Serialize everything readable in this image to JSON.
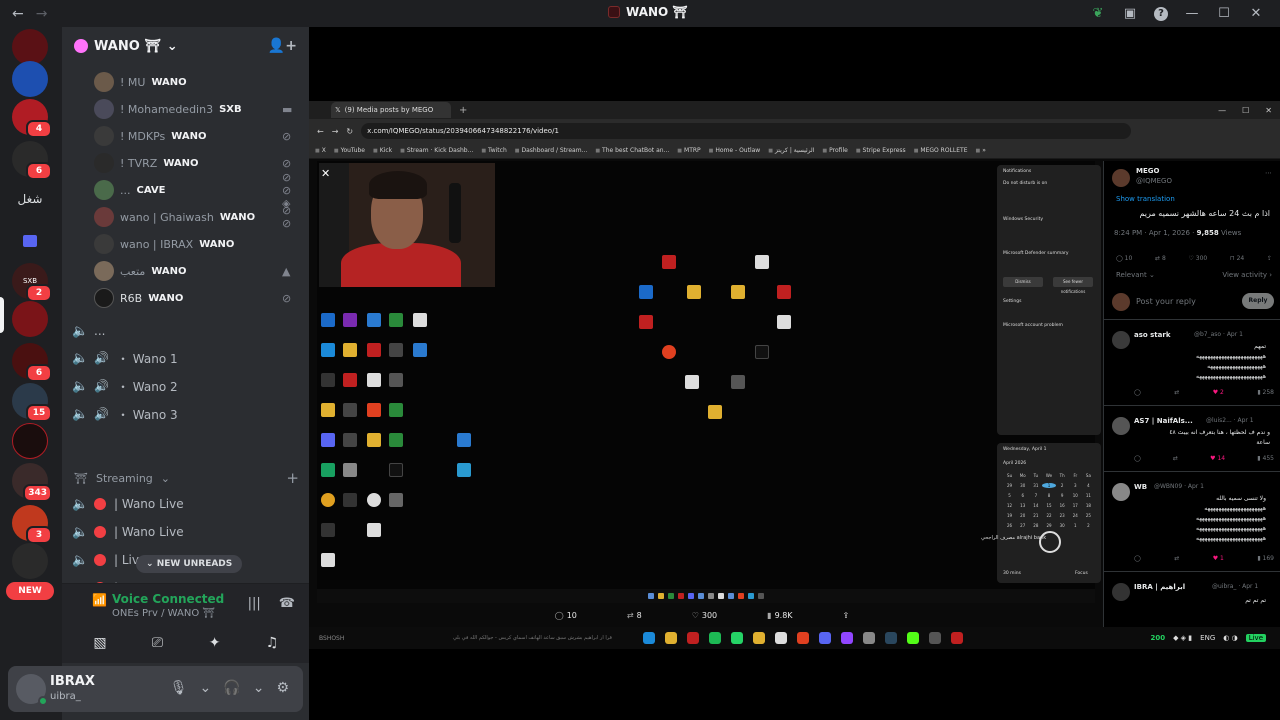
{
  "titlebar": {
    "back": "←",
    "forward": "→",
    "title": "WANO ⛩",
    "icons": [
      "leaf-icon",
      "inbox-icon",
      "help-icon",
      "minimize-icon",
      "maximize-icon",
      "close-icon"
    ],
    "help": "?",
    "minimize": "—",
    "maximize": "☐",
    "close": "✕"
  },
  "rail": {
    "badges": [
      "4",
      "6",
      "2",
      "15",
      "343",
      "3"
    ],
    "new_label": "NEW",
    "labels": {
      "shogl": "شغل",
      "sxb": "SXB"
    }
  },
  "server": {
    "name": "WANO ⛩",
    "chevron": "⌄"
  },
  "voice_members": [
    {
      "name": "! MU",
      "tag": "WANO"
    },
    {
      "name": "! Mohamededin3",
      "tag": "SXB"
    },
    {
      "name": "! MDKPs",
      "tag": "WANO"
    },
    {
      "name": "! TVRZ",
      "tag": "WANO"
    },
    {
      "name": "...",
      "tag": "CAVE"
    },
    {
      "name": "wano | Ghaiwash",
      "tag": "WANO"
    },
    {
      "name": "wano | IBRAX",
      "tag": "WANO"
    },
    {
      "name": "متعب",
      "tag": "WANO"
    },
    {
      "name": "R6B",
      "tag": "WANO"
    }
  ],
  "channels": [
    {
      "name": "..."
    },
    {
      "name": "・ Wano 1"
    },
    {
      "name": "・ Wano 2"
    },
    {
      "name": "・ Wano 3"
    }
  ],
  "category": {
    "name": "Streaming",
    "plus": "+"
  },
  "stream_channels": [
    {
      "name": "| Wano Live"
    },
    {
      "name": "| Wano Live"
    },
    {
      "name": "| Live 1"
    },
    {
      "name": "| L"
    }
  ],
  "new_unreads": "NEW UNREADS",
  "voice": {
    "status": "Voice Connected",
    "location": "ONEs Prv / WANO ⛩"
  },
  "user": {
    "name": "IBRAX",
    "handle": "uibra_"
  },
  "shared_screen": {
    "tab_title": "(9) Media posts by MEGO",
    "url": "x.com/IQMEGO/status/2039406647348822176/video/1",
    "bookmarks": [
      "X",
      "YouTube",
      "Kick",
      "Stream · Kick Dashb...",
      "Twitch",
      "Dashboard / Stream...",
      "The best ChatBot an...",
      "MTRP",
      "Home - Outlaw",
      "الرئيسية | كريتز",
      "Profile",
      "Stripe Express",
      "MEGO ROLLETE",
      "»"
    ],
    "stats": {
      "replies": "10",
      "reposts": "8",
      "likes": "300",
      "views": "9.8K"
    },
    "notifications": {
      "title": "Notifications",
      "dnd": "Do not disturb is on",
      "security": "Windows Security",
      "defender": "Microsoft Defender summary",
      "dismiss": "Dismiss",
      "see_more": "See fewer notifications",
      "settings": "Settings",
      "problem": "Microsoft account problem"
    },
    "calendar": {
      "day": "Wednesday, April 1",
      "month": "April 2026",
      "focus": "30 mins",
      "focus_btn": "Focus",
      "weekdays": [
        "Su",
        "Mo",
        "Tu",
        "We",
        "Th",
        "Fr",
        "Sa"
      ],
      "days": [
        "29",
        "30",
        "31",
        "1",
        "2",
        "3",
        "4",
        "5",
        "6",
        "7",
        "8",
        "9",
        "10",
        "11",
        "12",
        "13",
        "14",
        "15",
        "16",
        "17",
        "18",
        "19",
        "20",
        "21",
        "22",
        "23",
        "24",
        "25",
        "26",
        "27",
        "28",
        "29",
        "30",
        "1",
        "2"
      ]
    },
    "bank": "مصرف الراجحي alrajhi bank",
    "taskbar": {
      "coins": "200",
      "lang": "ENG",
      "chat_user": "BSHOSH",
      "chat_msg": "قرا ار ابراهيم بشرش سبق ساعد الهاتف اسماي كريس - جوالكم الله في بلي",
      "live": "Live"
    },
    "x_post": {
      "author": "MEGO",
      "handle": "@IQMEGO",
      "translate": "Show translation",
      "text": "اذا م بث 24 ساعه هالشهر نسميه مريم",
      "time": "8:24 PM · Apr 1, 2026 · ",
      "views": "9,858",
      "views_label": " Views",
      "replies": "10",
      "reposts": "8",
      "likes": "300",
      "bookmarks": "24",
      "relevant": "Relevant ⌄",
      "view_activity": "View activity ›",
      "reply_placeholder": "Post your reply",
      "reply_btn": "Reply",
      "comments": [
        {
          "name": "aso stark",
          "handle": "@b7_aso · Apr 1",
          "lines": [
            "تمهم",
            "ههههههههههههههههههههههههه",
            "ههههههههههههههههههههه",
            "ههههههههههههههههههههههههه"
          ],
          "likes": "2",
          "views": "258"
        },
        {
          "name": "AS7 | NaifAls...",
          "handle": "@luis2... · Apr 1",
          "lines": [
            "و ندم ف لحظتها ، هنا بتعرف انه بيبث ٤٨",
            "ساعة"
          ],
          "likes": "14",
          "views": "455"
        },
        {
          "name": "WB",
          "handle": "@WBN09 · Apr 1",
          "lines": [
            "ولا تنسى سميه بالله",
            "هههههههههههههههههههههه",
            "ههههههههههههههههههههههههه",
            "ههههههههههههههههههههههههه",
            "ههههههههههههههههههههههههه"
          ],
          "likes": "1",
          "views": "169"
        },
        {
          "name": "IBRA | ابراهيم",
          "handle": "@uibra_ · Apr 1",
          "lines": [
            "تم تم تم"
          ],
          "likes": "",
          "views": ""
        }
      ]
    }
  }
}
